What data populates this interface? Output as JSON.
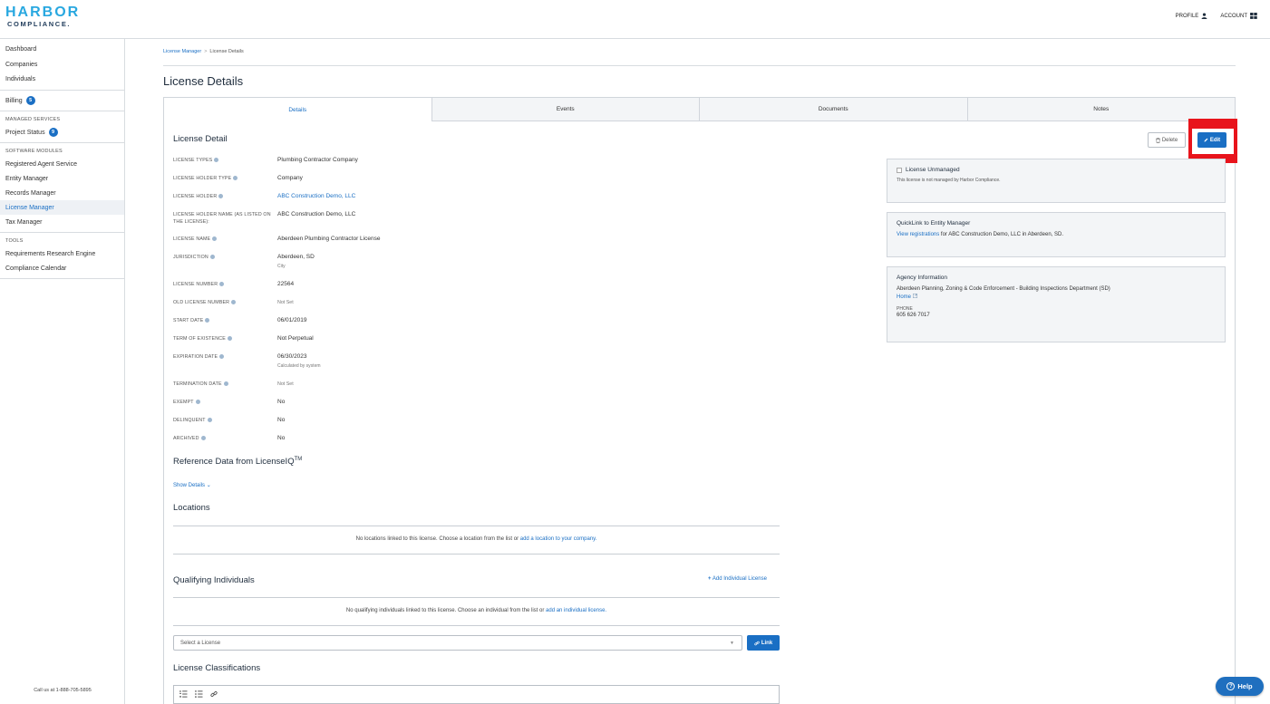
{
  "header": {
    "logo_top": "HARBOR",
    "logo_bottom": "COMPLIANCE.",
    "profile_label": "PROFILE",
    "account_label": "ACCOUNT"
  },
  "sidebar": {
    "items_top": [
      "Dashboard",
      "Companies",
      "Individuals"
    ],
    "billing_label": "Billing",
    "billing_badge": "5",
    "managed_services_head": "MANAGED SERVICES",
    "project_status_label": "Project Status",
    "project_status_badge": "9",
    "software_modules_head": "SOFTWARE MODULES",
    "modules": [
      "Registered Agent Service",
      "Entity Manager",
      "Records Manager",
      "License Manager",
      "Tax Manager"
    ],
    "tools_head": "TOOLS",
    "tools": [
      "Requirements Research Engine",
      "Compliance Calendar"
    ],
    "footer": "Call us at 1-888-705-5895"
  },
  "breadcrumb": {
    "root": "License Manager",
    "sep": ">",
    "current": "License Details"
  },
  "page_title": "License Details",
  "tabs": [
    "Details",
    "Events",
    "Documents",
    "Notes"
  ],
  "detail": {
    "section_title": "License Detail",
    "delete_label": "Delete",
    "edit_label": "Edit",
    "fields": [
      {
        "label": "LICENSE TYPES",
        "value": "Plumbing Contractor Company"
      },
      {
        "label": "LICENSE HOLDER TYPE",
        "value": "Company"
      },
      {
        "label": "LICENSE HOLDER",
        "value": "ABC Construction Demo, LLC"
      },
      {
        "label": "LICENSE HOLDER NAME (AS LISTED ON THE LICENSE):",
        "value": "ABC Construction Demo, LLC"
      },
      {
        "label": "LICENSE NAME",
        "value": "Aberdeen Plumbing Contractor License"
      },
      {
        "label": "JURISDICTION",
        "value": "Aberdeen, SD",
        "sub": "City"
      },
      {
        "label": "LICENSE NUMBER",
        "value": "22564"
      },
      {
        "label": "OLD LICENSE NUMBER",
        "value": "Not Set"
      },
      {
        "label": "START DATE",
        "value": "06/01/2019"
      },
      {
        "label": "TERM OF EXISTENCE",
        "value": "Not Perpetual"
      },
      {
        "label": "EXPIRATION DATE",
        "value": "06/30/2023",
        "sub": "Calculated by system"
      },
      {
        "label": "TERMINATION DATE",
        "value": "Not Set"
      },
      {
        "label": "EXEMPT",
        "value": "No"
      },
      {
        "label": "DELINQUENT",
        "value": "No"
      },
      {
        "label": "ARCHIVED",
        "value": "No"
      }
    ]
  },
  "right": {
    "unmanaged_title": "License Unmanaged",
    "unmanaged_text": "This license is not managed by Harbor Compliance.",
    "quicklink_title": "QuickLink to Entity Manager",
    "quicklink_link": "View registrations",
    "quicklink_rest": "for ABC Construction Demo, LLC in Aberdeen, SD.",
    "agency_title": "Agency Information",
    "agency_name": "Aberdeen Planning, Zoning & Code Enforcement - Building Inspections Department (SD)",
    "agency_home": "Home",
    "phone_label": "PHONE",
    "phone_value": "605 626 7017"
  },
  "reference": {
    "title": "Reference Data from LicenseIQ",
    "title_sup": "TM",
    "show_details": "Show Details"
  },
  "locations": {
    "title": "Locations",
    "empty_text": "No locations linked to this license. Choose a location from the list or",
    "empty_link": "add a location to your company."
  },
  "qualifying": {
    "title": "Qualifying Individuals",
    "add_label": "Add Individual License",
    "empty_text": "No qualifying individuals linked to this license. Choose an individual from the list or",
    "empty_link": "add an individual license.",
    "select_placeholder": "Select a License",
    "link_label": "Link"
  },
  "classifications": {
    "title": "License Classifications"
  },
  "help_label": "Help"
}
